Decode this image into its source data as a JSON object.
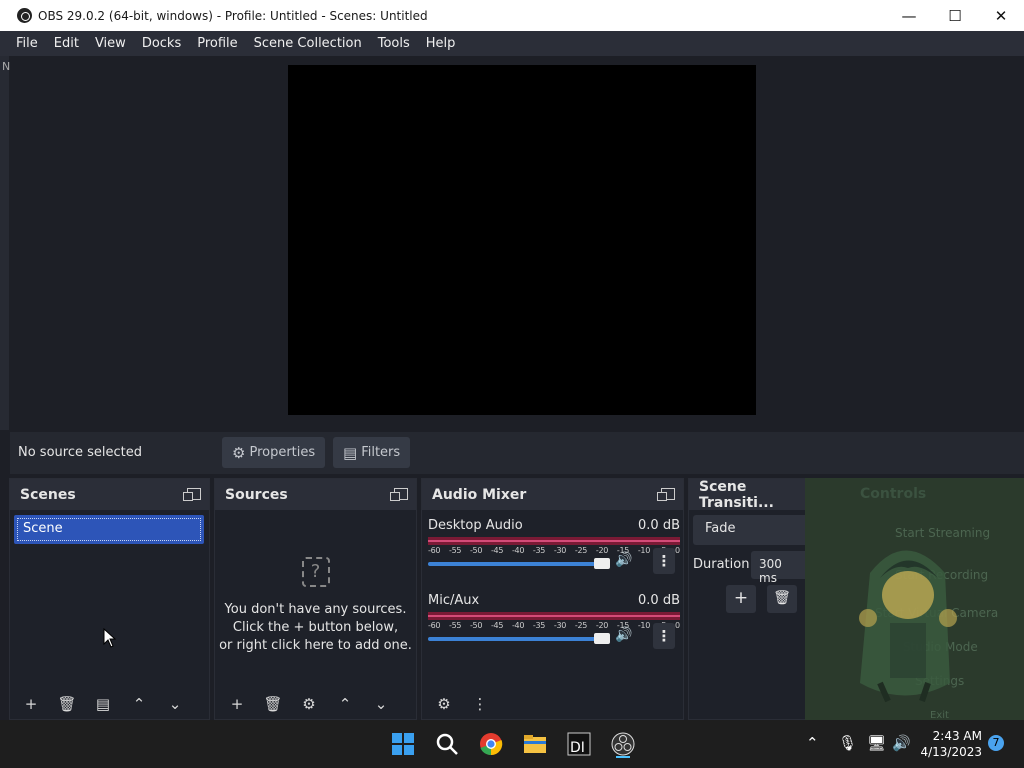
{
  "window": {
    "title": "OBS 29.0.2 (64-bit, windows) - Profile: Untitled - Scenes: Untitled",
    "minimize": "—",
    "maximize": "☐",
    "close": "✕"
  },
  "menu": [
    "File",
    "Edit",
    "View",
    "Docks",
    "Profile",
    "Scene Collection",
    "Tools",
    "Help"
  ],
  "preview": {
    "edge_letter": "N"
  },
  "source_bar": {
    "status": "No source selected",
    "properties": "Properties",
    "filters": "Filters"
  },
  "scenes": {
    "title": "Scenes",
    "items": [
      "Scene"
    ]
  },
  "sources": {
    "title": "Sources",
    "empty_line1": "You don't have any sources.",
    "empty_line2": "Click the + button below,",
    "empty_line3": "or right click here to add one.",
    "q": "?"
  },
  "audio": {
    "title": "Audio Mixer",
    "scale": [
      "-60",
      "-55",
      "-50",
      "-45",
      "-40",
      "-35",
      "-30",
      "-25",
      "-20",
      "-15",
      "-10",
      "-5",
      "0"
    ],
    "channels": [
      {
        "name": "Desktop Audio",
        "level": "0.0 dB",
        "volume_fraction": 1.0
      },
      {
        "name": "Mic/Aux",
        "level": "0.0 dB",
        "volume_fraction": 1.0
      }
    ]
  },
  "transitions": {
    "title": "Scene Transiti...",
    "selected": "Fade",
    "duration_label": "Duration",
    "duration_value": "300 ms"
  },
  "controls": {
    "title": "Controls",
    "items": [
      "Start Streaming",
      "Start Recording",
      "Start Virtual Camera",
      "Studio Mode",
      "Settings",
      "Exit"
    ]
  },
  "taskbar": {
    "time": "2:43 AM",
    "date": "4/13/2023",
    "notifications": "7"
  },
  "colors": {
    "accent": "#2d55b8",
    "meter": "#d44b78",
    "volume": "#3c82d6"
  }
}
